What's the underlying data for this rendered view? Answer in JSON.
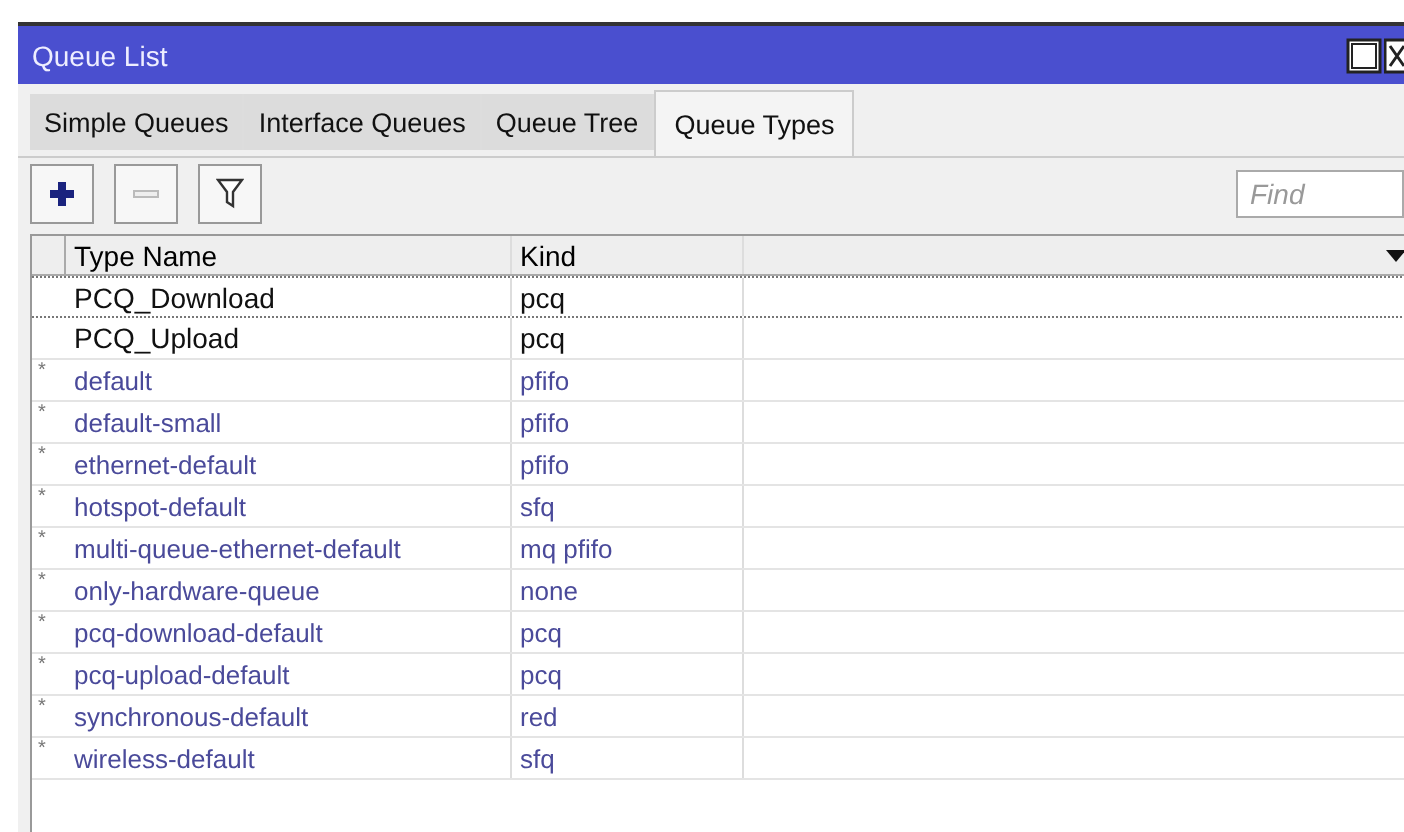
{
  "window": {
    "title": "Queue List"
  },
  "tabs": [
    {
      "label": "Simple Queues",
      "selected": false
    },
    {
      "label": "Interface Queues",
      "selected": false
    },
    {
      "label": "Queue Tree",
      "selected": false
    },
    {
      "label": "Queue Types",
      "selected": true
    }
  ],
  "search": {
    "placeholder": "Find"
  },
  "table": {
    "columns": [
      "Type Name",
      "Kind"
    ],
    "rows": [
      {
        "flag": "",
        "name": "PCQ_Download",
        "kind": "pcq",
        "default": false,
        "focused": true
      },
      {
        "flag": "",
        "name": "PCQ_Upload",
        "kind": "pcq",
        "default": false,
        "focused": false
      },
      {
        "flag": "*",
        "name": "default",
        "kind": "pfifo",
        "default": true,
        "focused": false
      },
      {
        "flag": "*",
        "name": "default-small",
        "kind": "pfifo",
        "default": true,
        "focused": false
      },
      {
        "flag": "*",
        "name": "ethernet-default",
        "kind": "pfifo",
        "default": true,
        "focused": false
      },
      {
        "flag": "*",
        "name": "hotspot-default",
        "kind": "sfq",
        "default": true,
        "focused": false
      },
      {
        "flag": "*",
        "name": "multi-queue-ethernet-default",
        "kind": "mq pfifo",
        "default": true,
        "focused": false
      },
      {
        "flag": "*",
        "name": "only-hardware-queue",
        "kind": "none",
        "default": true,
        "focused": false
      },
      {
        "flag": "*",
        "name": "pcq-download-default",
        "kind": "pcq",
        "default": true,
        "focused": false
      },
      {
        "flag": "*",
        "name": "pcq-upload-default",
        "kind": "pcq",
        "default": true,
        "focused": false
      },
      {
        "flag": "*",
        "name": "synchronous-default",
        "kind": "red",
        "default": true,
        "focused": false
      },
      {
        "flag": "*",
        "name": "wireless-default",
        "kind": "sfq",
        "default": true,
        "focused": false
      }
    ]
  }
}
